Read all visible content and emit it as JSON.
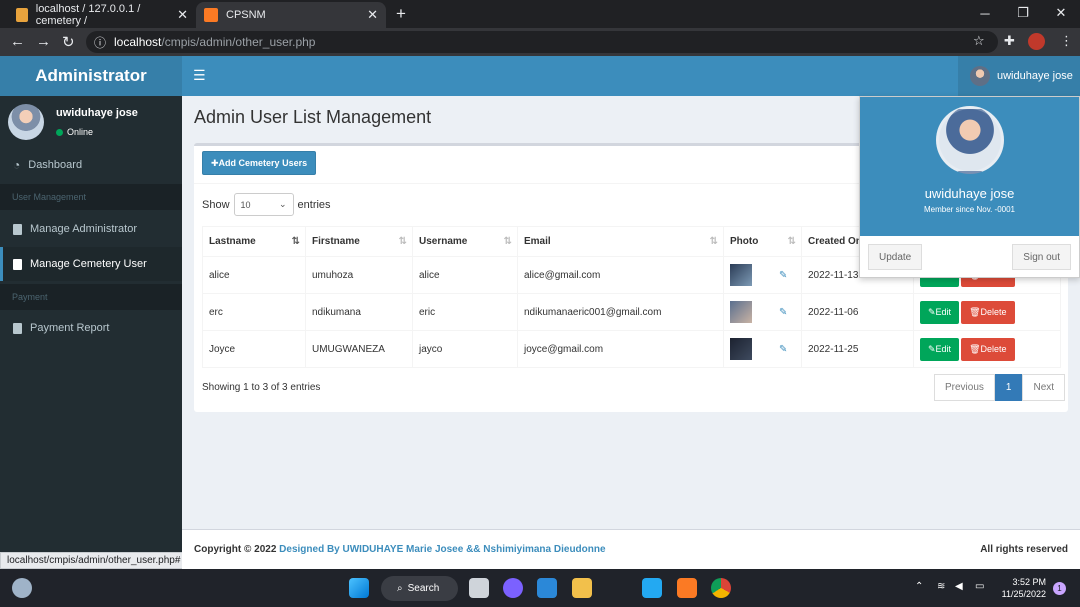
{
  "browser": {
    "tabs": [
      {
        "title": "localhost / 127.0.0.1 / cemetery /"
      },
      {
        "title": "CPSNM"
      }
    ],
    "url_host": "localhost",
    "url_path": "/cmpis/admin/other_user.php",
    "status_url": "localhost/cmpis/admin/other_user.php#"
  },
  "header": {
    "logo": "Administrator",
    "user_name": "uwiduhaye jose"
  },
  "sidebar": {
    "user_name": "uwiduhaye jose",
    "status": "Online",
    "items": [
      {
        "label": "Dashboard"
      },
      {
        "section": "User Management"
      },
      {
        "label": "Manage Administrator"
      },
      {
        "label": "Manage Cemetery User"
      },
      {
        "section": "Payment"
      },
      {
        "label": "Payment Report"
      }
    ]
  },
  "main": {
    "title": "Admin User List Management",
    "add_button": "Add Cemetery Users",
    "show_label": "Show",
    "entries_value": "10",
    "entries_label": "entries",
    "columns": [
      "Lastname",
      "Firstname",
      "Username",
      "Email",
      "Photo",
      "Created On"
    ],
    "rows": [
      {
        "lastname": "alice",
        "firstname": "umuhoza",
        "username": "alice",
        "email": "alice@gmail.com",
        "created": "2022-11-13"
      },
      {
        "lastname": "erc",
        "firstname": "ndikumana",
        "username": "eric",
        "email": "ndikumanaeric001@gmail.com",
        "created": "2022-11-06"
      },
      {
        "lastname": "Joyce",
        "firstname": "UMUGWANEZA",
        "username": "jayco",
        "email": "joyce@gmail.com",
        "created": "2022-11-25"
      }
    ],
    "edit_label": "Edit",
    "delete_label": "Delete",
    "info": "Showing 1 to 3 of 3 entries",
    "pager": {
      "prev": "Previous",
      "page": "1",
      "next": "Next"
    }
  },
  "dropdown": {
    "name": "uwiduhaye jose",
    "member_since": "Member since Nov. -0001",
    "update": "Update",
    "signout": "Sign out"
  },
  "footer": {
    "copyright": "Copyright © 2022",
    "designed_by": "Designed By UWIDUHAYE Marie Josee && Nshimiyimana Dieudonne",
    "rights": "All rights reserved"
  },
  "taskbar": {
    "search": "Search",
    "time": "3:52 PM",
    "date": "11/25/2022",
    "notifications": "1"
  },
  "colors": {
    "primary": "#3c8dbc",
    "sidebar": "#222d32",
    "success": "#00a65a",
    "danger": "#dd4b39"
  }
}
